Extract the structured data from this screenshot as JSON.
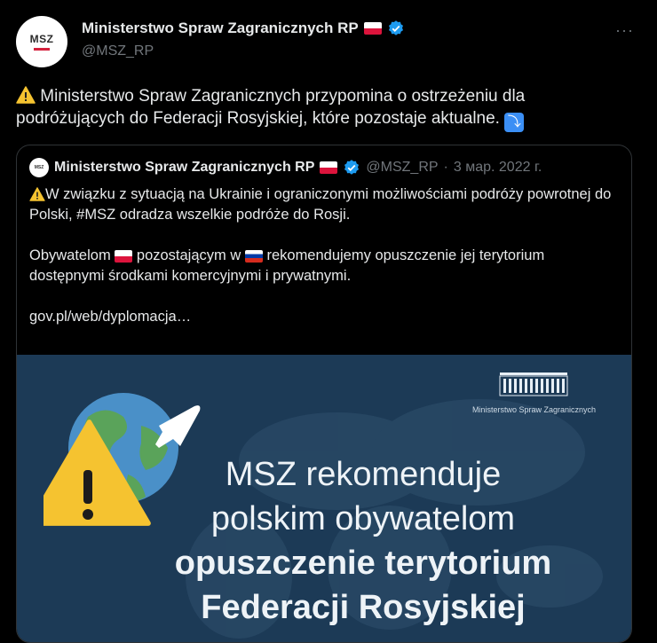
{
  "tweet": {
    "avatar_text": "MSZ",
    "author_name": "Ministerstwo Spraw Zagranicznych RP",
    "handle": "@MSZ_RP",
    "text": "Ministerstwo Spraw Zagranicznych przypomina o ostrzeżeniu dla podróżujących do Federacji Rosyjskiej, które pozostaje aktualne.",
    "more_label": "···"
  },
  "quote": {
    "author_name": "Ministerstwo Spraw Zagranicznych RP",
    "handle": "@MSZ_RP",
    "separator": "·",
    "date": "3 мар. 2022 г.",
    "line1": "W związku z sytuacją na Ukrainie i ograniczonymi możliwościami podróży powrotnej do Polski, #MSZ odradza wszelkie podróże do Rosji.",
    "line2_a": "Obywatelom",
    "line2_b": "pozostającym w",
    "line2_c": "rekomendujemy opuszczenie jej terytorium dostępnymi środkami komercyjnymi i prywatnymi.",
    "link": "gov.pl/web/dyplomacja…"
  },
  "image": {
    "logo_label": "Ministerstwo Spraw Zagranicznych",
    "line1": "MSZ rekomenduje",
    "line2": "polskim obywatelom",
    "line3": "opuszczenie terytorium",
    "line4": "Federacji Rosyjskiej",
    "bg_color": "#1c3a56"
  },
  "colors": {
    "accent": "#1d9bf0",
    "text": "#e7e9ea",
    "muted": "#71767b",
    "warning": "#f5c330"
  }
}
